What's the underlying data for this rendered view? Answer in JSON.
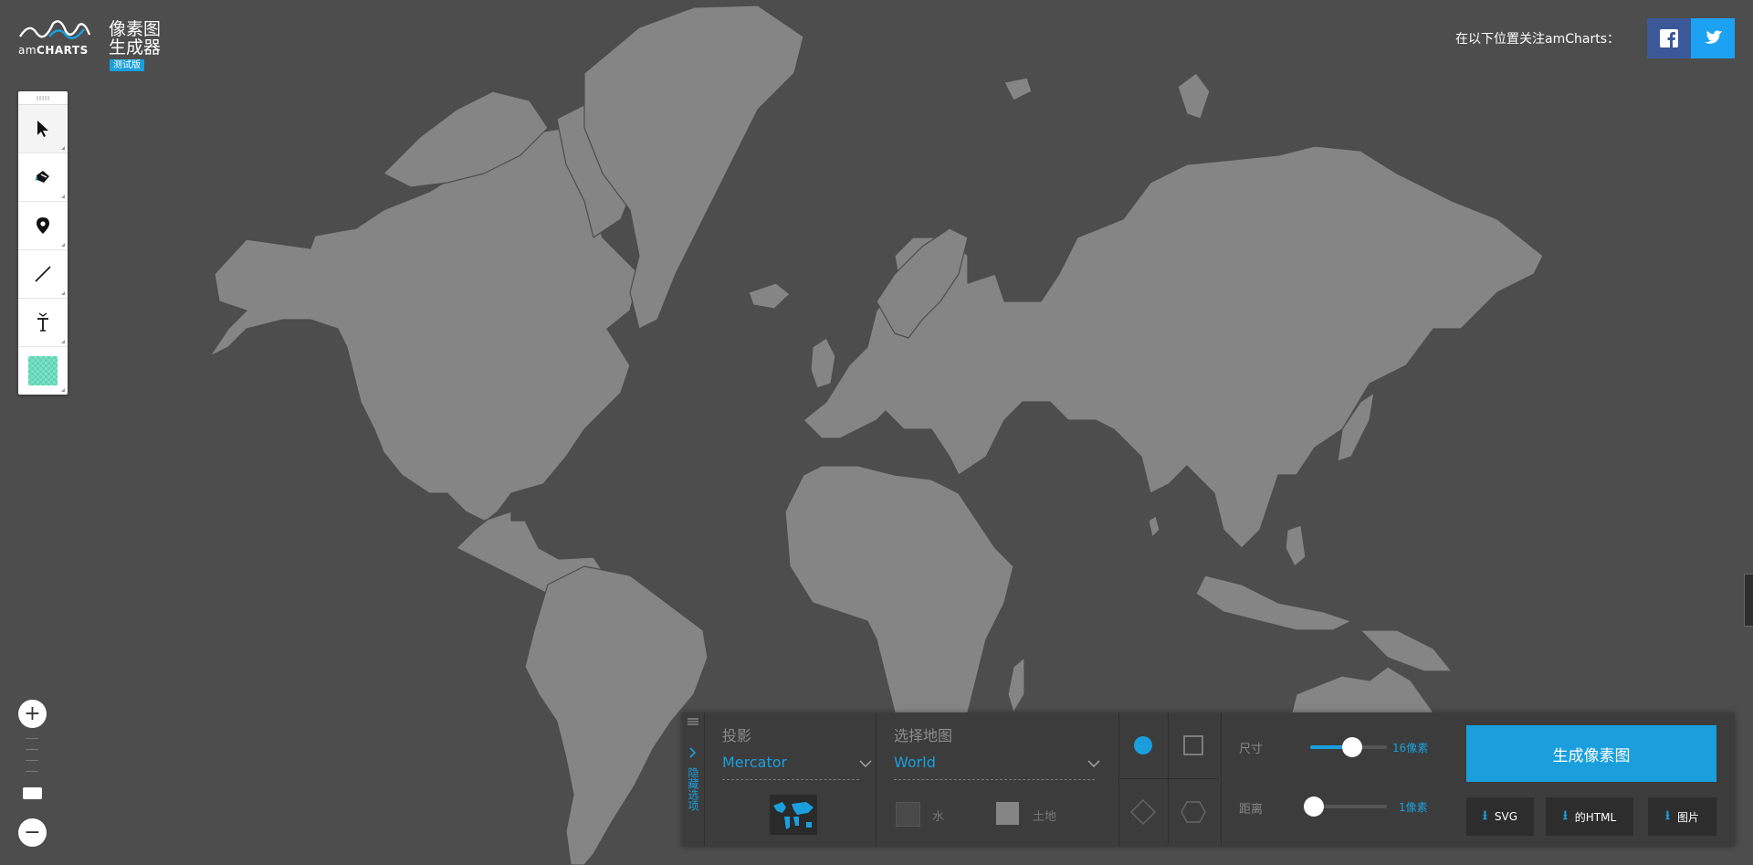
{
  "app": {
    "logo_text_light": "am",
    "logo_text_bold": "CHARTS",
    "title_line1": "像素图",
    "title_line2": "生成器",
    "beta_badge": "测试版"
  },
  "header": {
    "follow_text": "在以下位置关注amCharts："
  },
  "toolbar": {
    "tools": [
      {
        "name": "select-tool",
        "icon": "cursor-icon"
      },
      {
        "name": "fill-tool",
        "icon": "paint-bucket-icon"
      },
      {
        "name": "marker-tool",
        "icon": "map-pin-icon"
      },
      {
        "name": "line-tool",
        "icon": "line-icon"
      },
      {
        "name": "text-tool",
        "icon": "text-icon"
      },
      {
        "name": "color-tool",
        "icon": "color-swatch-icon"
      }
    ]
  },
  "zoom": {
    "in_label": "+",
    "out_label": "−"
  },
  "panel": {
    "hide_options_label": "隐藏选项",
    "projection": {
      "label": "投影",
      "value": "Mercator"
    },
    "map_select": {
      "label": "选择地图",
      "value": "World"
    },
    "colors": {
      "water_label": "水",
      "land_label": "土地",
      "water_color": "#4a4a4a",
      "land_color": "#858585"
    },
    "size": {
      "label": "尺寸",
      "value": "16像素",
      "level": 0.5
    },
    "distance": {
      "label": "距离",
      "value": "1像素",
      "level": 0.0
    },
    "generate_button": "生成像素图",
    "downloads": [
      {
        "label": "SVG"
      },
      {
        "label": "的HTML"
      },
      {
        "label": "图片"
      }
    ]
  },
  "colors": {
    "accent": "#1a9fdc",
    "background": "#4d4d4d",
    "land": "#858585"
  }
}
